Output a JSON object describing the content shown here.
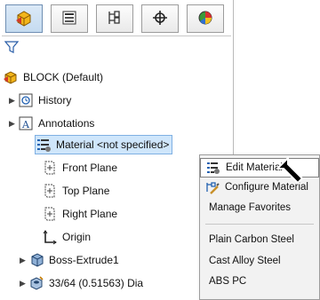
{
  "toolbar": {
    "tabs": [
      {
        "name": "feature-manager",
        "icon": "feature-tree-icon"
      },
      {
        "name": "property-manager",
        "icon": "property-manager-icon"
      },
      {
        "name": "configuration-manager",
        "icon": "configuration-icon"
      },
      {
        "name": "dimxpert-manager",
        "icon": "dimxpert-icon"
      },
      {
        "name": "display-manager",
        "icon": "display-pie-icon"
      }
    ],
    "colors": {
      "active_tab": "#c5dbf0",
      "selection": "#cfe6fb",
      "accent": "#f0b400"
    }
  },
  "tree": {
    "root_label": "BLOCK  (Default)",
    "history_label": "History",
    "annotations_label": "Annotations",
    "material_label": "Material <not specified>",
    "front_plane_label": "Front Plane",
    "top_plane_label": "Top Plane",
    "right_plane_label": "Right Plane",
    "origin_label": "Origin",
    "boss_extrude_label": "Boss-Extrude1",
    "hole_label": "33/64 (0.51563) Dia"
  },
  "context_menu": {
    "edit_material": "Edit Material",
    "configure_material": "Configure Material",
    "manage_favorites": "Manage Favorites",
    "favorites": [
      "Plain Carbon Steel",
      "Cast Alloy Steel",
      "ABS PC"
    ]
  }
}
